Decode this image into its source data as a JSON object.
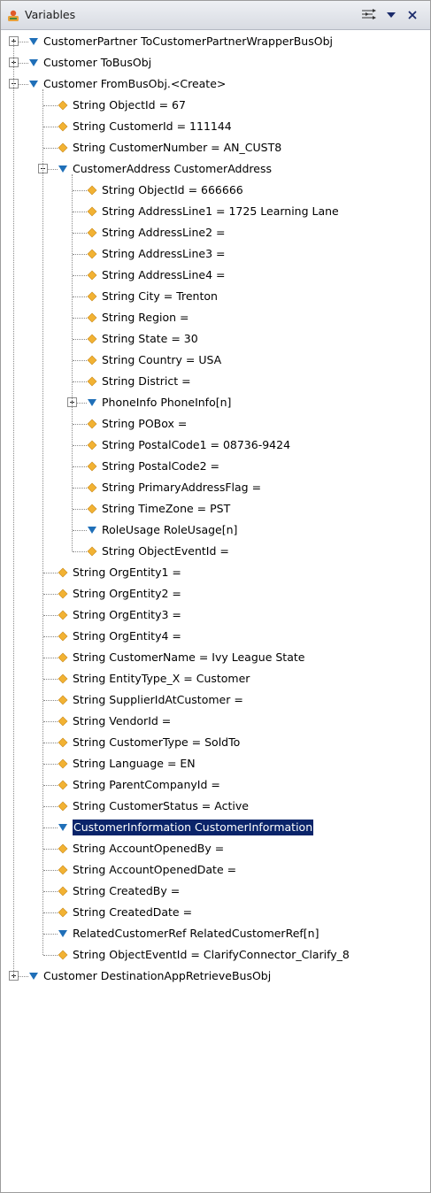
{
  "panel": {
    "title": "Variables",
    "icon": "variables-view-icon",
    "toolbar": [
      {
        "name": "collapse-all-icon"
      },
      {
        "name": "view-menu-icon"
      },
      {
        "name": "close-icon"
      }
    ]
  },
  "tree": [
    {
      "depth": 0,
      "kind": "object",
      "expander": "plus",
      "label": "CustomerPartner  ToCustomerPartnerWrapperBusObj"
    },
    {
      "depth": 0,
      "kind": "object",
      "expander": "plus",
      "label": "Customer  ToBusObj"
    },
    {
      "depth": 0,
      "kind": "object",
      "expander": "minus",
      "label": "Customer  FromBusObj.<Create>"
    },
    {
      "depth": 1,
      "kind": "string",
      "label": "String  ObjectId = 67"
    },
    {
      "depth": 1,
      "kind": "string",
      "label": "String  CustomerId = 111144"
    },
    {
      "depth": 1,
      "kind": "string",
      "label": "String  CustomerNumber = AN_CUST8"
    },
    {
      "depth": 1,
      "kind": "object",
      "expander": "minus",
      "label": "CustomerAddress  CustomerAddress"
    },
    {
      "depth": 2,
      "kind": "string",
      "label": "String  ObjectId = 666666"
    },
    {
      "depth": 2,
      "kind": "string",
      "label": "String  AddressLine1 = 1725 Learning Lane"
    },
    {
      "depth": 2,
      "kind": "string",
      "label": "String  AddressLine2 ="
    },
    {
      "depth": 2,
      "kind": "string",
      "label": "String  AddressLine3 ="
    },
    {
      "depth": 2,
      "kind": "string",
      "label": "String  AddressLine4 ="
    },
    {
      "depth": 2,
      "kind": "string",
      "label": "String  City = Trenton"
    },
    {
      "depth": 2,
      "kind": "string",
      "label": "String  Region ="
    },
    {
      "depth": 2,
      "kind": "string",
      "label": "String  State = 30"
    },
    {
      "depth": 2,
      "kind": "string",
      "label": "String  Country = USA"
    },
    {
      "depth": 2,
      "kind": "string",
      "label": "String  District ="
    },
    {
      "depth": 2,
      "kind": "object",
      "expander": "plus",
      "label": "PhoneInfo  PhoneInfo[n]"
    },
    {
      "depth": 2,
      "kind": "string",
      "label": "String  POBox ="
    },
    {
      "depth": 2,
      "kind": "string",
      "label": "String  PostalCode1 = 08736-9424"
    },
    {
      "depth": 2,
      "kind": "string",
      "label": "String  PostalCode2 ="
    },
    {
      "depth": 2,
      "kind": "string",
      "label": "String  PrimaryAddressFlag ="
    },
    {
      "depth": 2,
      "kind": "string",
      "label": "String  TimeZone = PST"
    },
    {
      "depth": 2,
      "kind": "object",
      "label": "RoleUsage  RoleUsage[n]"
    },
    {
      "depth": 2,
      "kind": "string",
      "label": "String  ObjectEventId ="
    },
    {
      "depth": 1,
      "kind": "string",
      "label": "String  OrgEntity1 ="
    },
    {
      "depth": 1,
      "kind": "string",
      "label": "String  OrgEntity2 ="
    },
    {
      "depth": 1,
      "kind": "string",
      "label": "String  OrgEntity3 ="
    },
    {
      "depth": 1,
      "kind": "string",
      "label": "String  OrgEntity4 ="
    },
    {
      "depth": 1,
      "kind": "string",
      "label": "String  CustomerName = Ivy League State"
    },
    {
      "depth": 1,
      "kind": "string",
      "label": "String  EntityType_X = Customer"
    },
    {
      "depth": 1,
      "kind": "string",
      "label": "String  SupplierIdAtCustomer ="
    },
    {
      "depth": 1,
      "kind": "string",
      "label": "String  VendorId ="
    },
    {
      "depth": 1,
      "kind": "string",
      "label": "String  CustomerType = SoldTo"
    },
    {
      "depth": 1,
      "kind": "string",
      "label": "String  Language = EN"
    },
    {
      "depth": 1,
      "kind": "string",
      "label": "String  ParentCompanyId ="
    },
    {
      "depth": 1,
      "kind": "string",
      "label": "String  CustomerStatus = Active"
    },
    {
      "depth": 1,
      "kind": "object",
      "selected": true,
      "label": "CustomerInformation  CustomerInformation"
    },
    {
      "depth": 1,
      "kind": "string",
      "label": "String  AccountOpenedBy ="
    },
    {
      "depth": 1,
      "kind": "string",
      "label": "String  AccountOpenedDate ="
    },
    {
      "depth": 1,
      "kind": "string",
      "label": "String  CreatedBy ="
    },
    {
      "depth": 1,
      "kind": "string",
      "label": "String  CreatedDate ="
    },
    {
      "depth": 1,
      "kind": "object",
      "label": "RelatedCustomerRef  RelatedCustomerRef[n]"
    },
    {
      "depth": 1,
      "kind": "string",
      "label": "String  ObjectEventId = ClarifyConnector_Clarify_8"
    },
    {
      "depth": 0,
      "kind": "object",
      "expander": "plus",
      "label": "Customer  DestinationAppRetrieveBusObj"
    }
  ],
  "colors": {
    "object_icon": "#1f6fb8",
    "string_icon": "#f2b233",
    "selection": "#0a246a",
    "titlebar_top": "#eef0f4",
    "titlebar_bottom": "#d8dbe2"
  }
}
